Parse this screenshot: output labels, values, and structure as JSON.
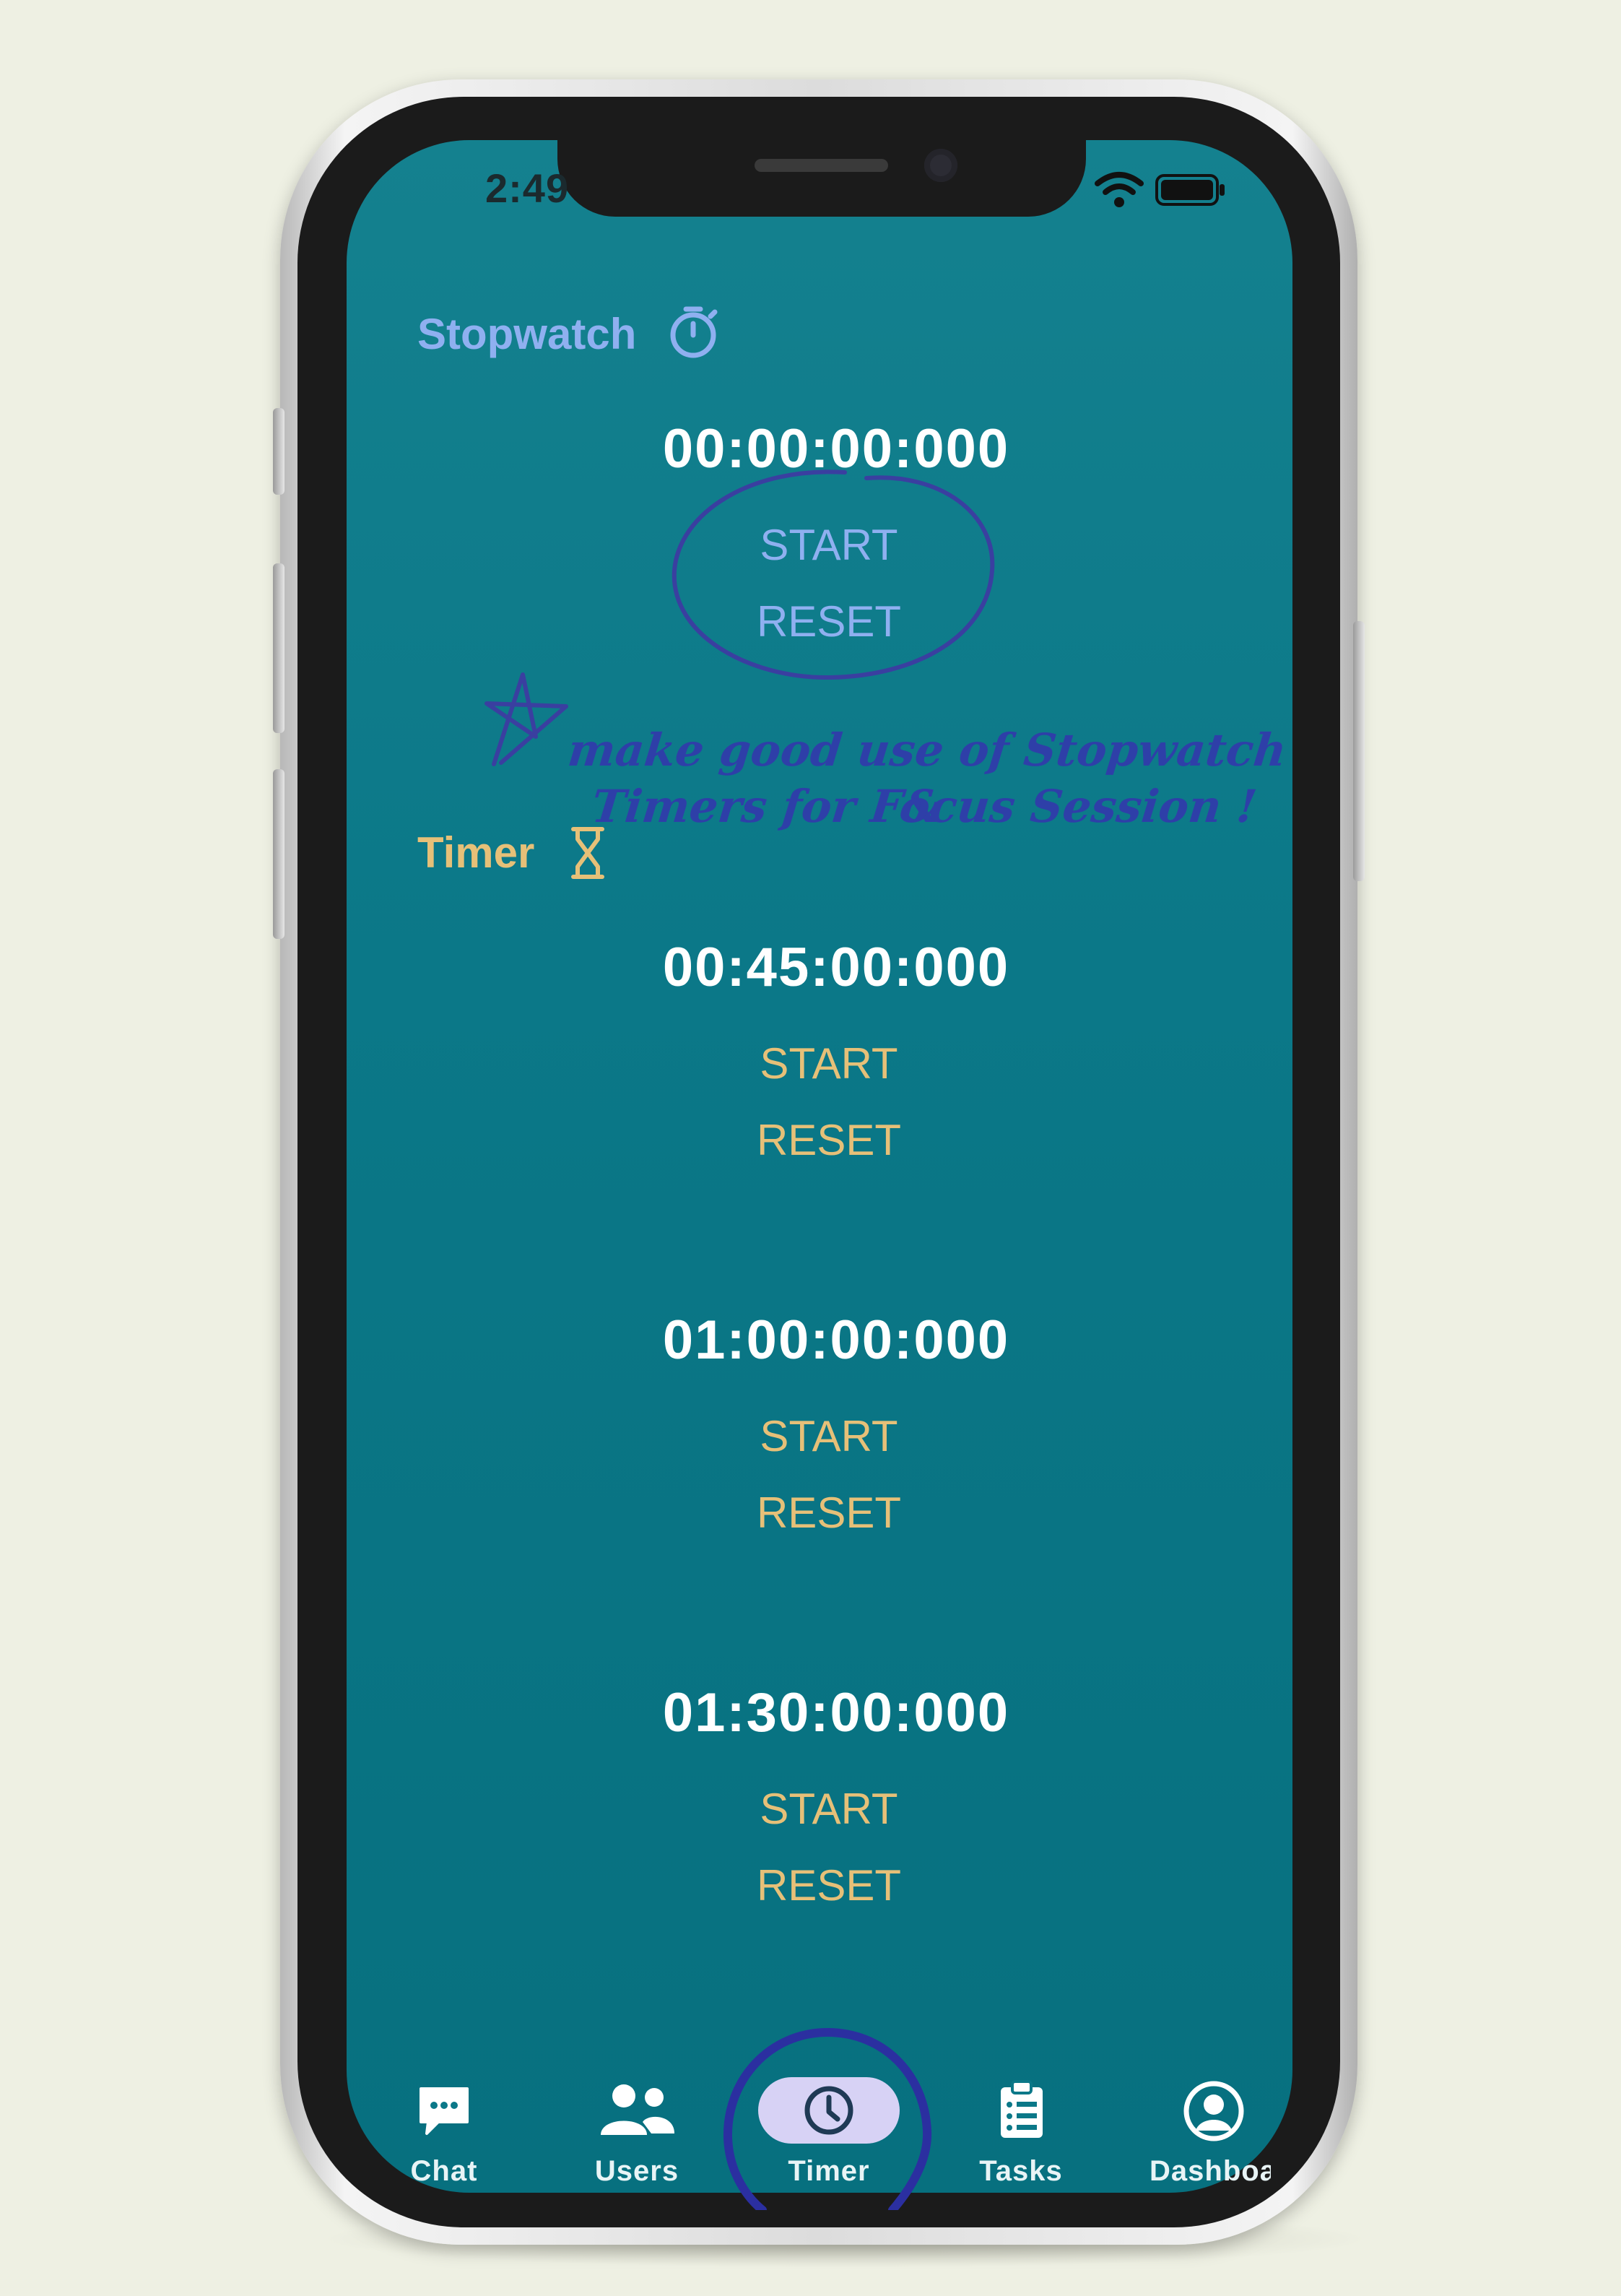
{
  "status_bar": {
    "time": "2:49"
  },
  "stopwatch": {
    "title": "Stopwatch",
    "icon": "stopwatch-icon",
    "time": "00:00:00:000",
    "start_label": "START",
    "reset_label": "RESET"
  },
  "annotation": {
    "text_line1": "make good use of Stopwatch &",
    "text_line2": "Timers for Focus Session !"
  },
  "timer": {
    "title": "Timer",
    "icon": "hourglass-icon",
    "items": [
      {
        "time": "00:45:00:000",
        "start_label": "START",
        "reset_label": "RESET"
      },
      {
        "time": "01:00:00:000",
        "start_label": "START",
        "reset_label": "RESET"
      },
      {
        "time": "01:30:00:000",
        "start_label": "START",
        "reset_label": "RESET"
      }
    ]
  },
  "bottom_nav": {
    "items": [
      {
        "label": "Chat",
        "icon": "chat-icon"
      },
      {
        "label": "Users",
        "icon": "users-icon"
      },
      {
        "label": "Timer",
        "icon": "clock-icon",
        "active": true
      },
      {
        "label": "Tasks",
        "icon": "clipboard-icon"
      },
      {
        "label": "Dashboa",
        "icon": "profile-icon"
      }
    ]
  },
  "colors": {
    "background": "#eef0e3",
    "screen": "#0b7888",
    "stopwatch_accent": "#8fb0f0",
    "timer_accent": "#e6c078",
    "annotation": "#2e3fa8",
    "nav_active_pill": "#d7d2f5"
  }
}
